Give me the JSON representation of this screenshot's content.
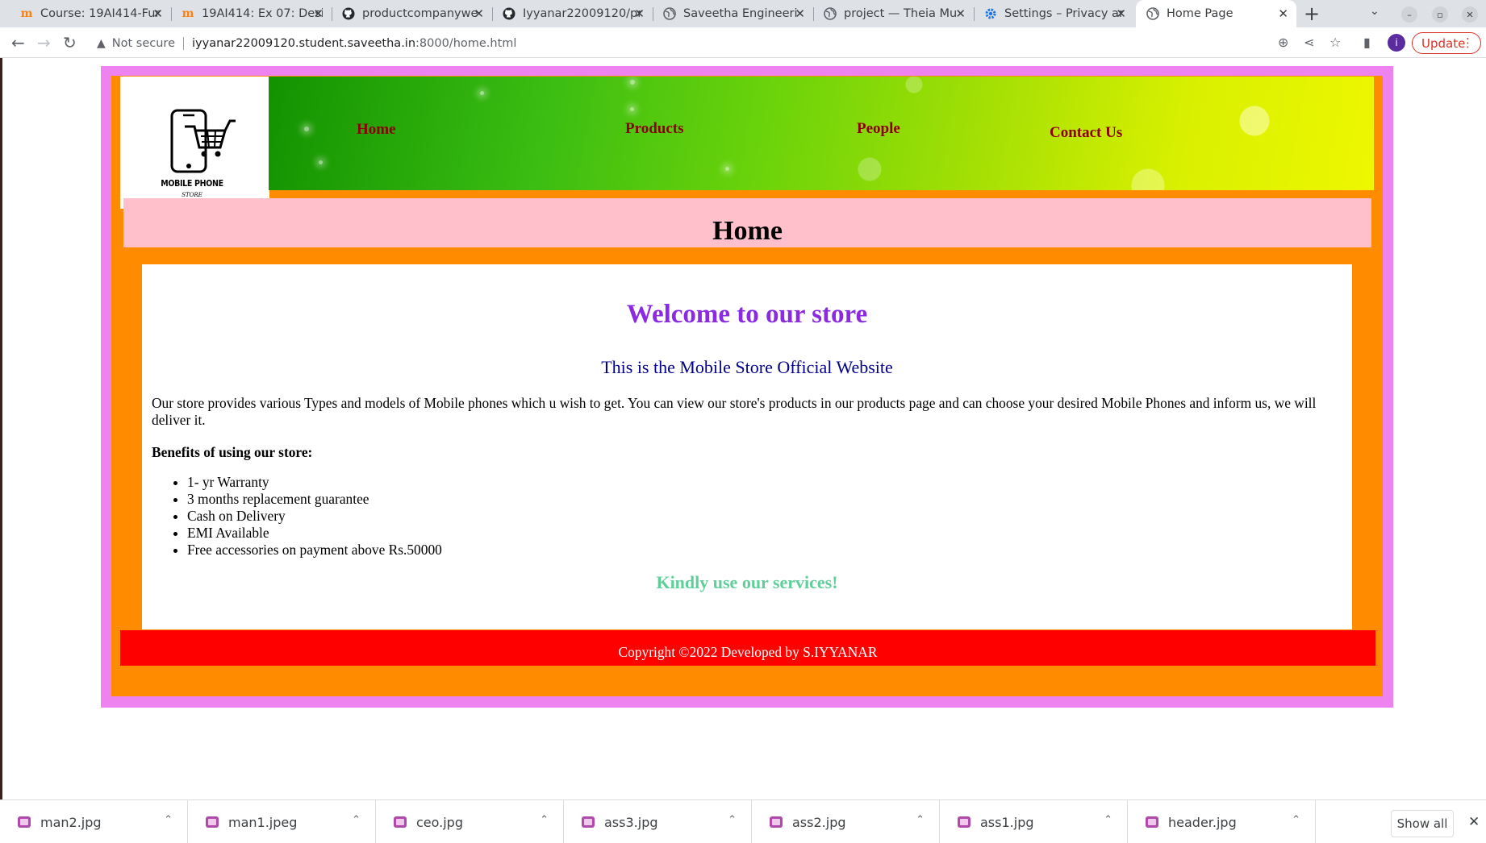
{
  "browser": {
    "tabs": [
      {
        "title": "Course: 19AI414-Fur",
        "icon": "moodle-icon"
      },
      {
        "title": "19AI414: Ex 07: Desi",
        "icon": "moodle-icon"
      },
      {
        "title": "productcompanywe",
        "icon": "github-icon"
      },
      {
        "title": "Iyyanar22009120/pr",
        "icon": "github-icon"
      },
      {
        "title": "Saveetha Engineeri",
        "icon": "globe-icon"
      },
      {
        "title": "project — Theia Mu",
        "icon": "globe-icon"
      },
      {
        "title": "Settings – Privacy ar",
        "icon": "gear-icon"
      },
      {
        "title": "Home Page",
        "icon": "globe-icon",
        "active": true
      }
    ],
    "security_label": "Not secure",
    "url_host": "iyyanar22009120.student.saveetha.in",
    "url_path": ":8000/home.html",
    "profile_initial": "i",
    "update_label": "Update"
  },
  "site": {
    "logo": {
      "line1": "MOBILE PHONE",
      "line2": "STORE"
    },
    "nav": [
      "Home",
      "Products",
      "People",
      "Contact Us"
    ],
    "page_heading": "Home",
    "welcome": "Welcome to our store",
    "subtitle": "This is the Mobile Store Official Website",
    "intro": "Our store provides various Types and models of Mobile phones which u wish to get. You can view our store's products in our products page and can choose your desired Mobile Phones and inform us, we will deliver it.",
    "benefits_heading": "Benefits of using our store:",
    "benefits": [
      "1- yr Warranty",
      "3 months replacement guarantee",
      "Cash on Delivery",
      "EMI Available",
      "Free accessories on payment above Rs.50000"
    ],
    "closing": "Kindly use our services!",
    "footer": "Copyright ©2022 Developed by S.IYYANAR"
  },
  "downloads": {
    "files": [
      "man2.jpg",
      "man1.jpeg",
      "ceo.jpg",
      "ass3.jpg",
      "ass2.jpg",
      "ass1.jpg",
      "header.jpg"
    ],
    "show_all_label": "Show all"
  },
  "colors": {
    "page_frame": "#ee82ee",
    "page_background": "#ff8c00",
    "heading_bar": "#ffc0cb",
    "nav_text": "#8b0000",
    "welcome_text": "#8a2be2",
    "subtitle_text": "#00008b",
    "closing_text": "#5fcf9a",
    "footer_background": "#ff0000"
  }
}
